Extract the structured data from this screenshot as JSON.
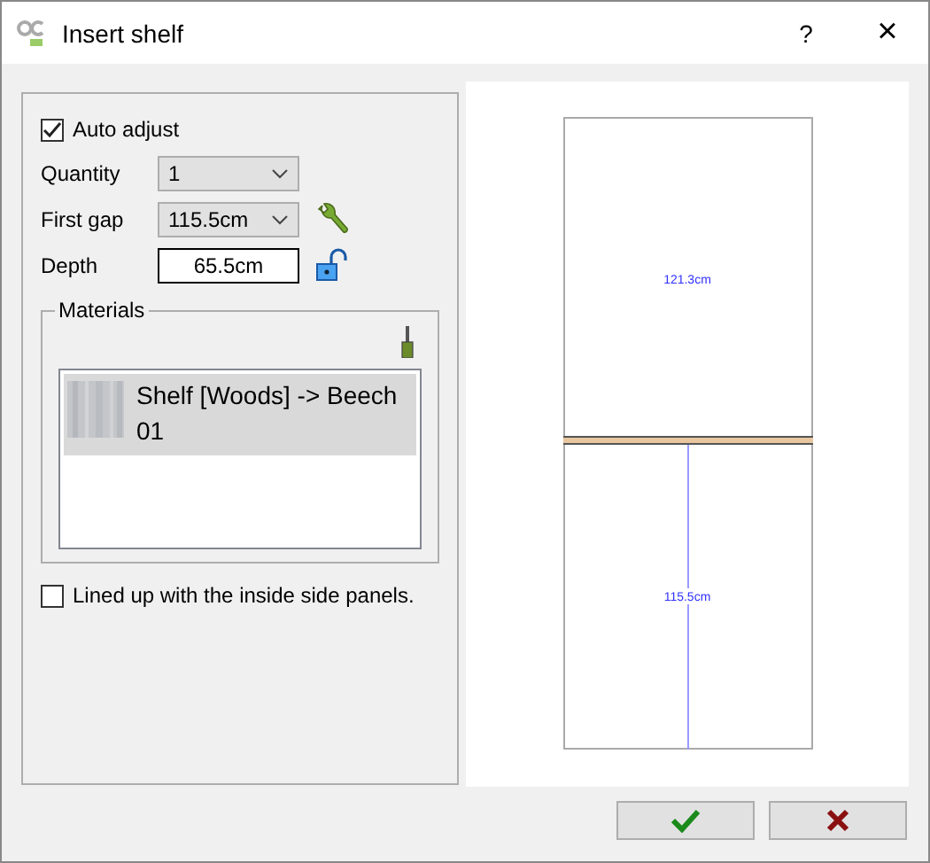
{
  "window": {
    "title": "Insert shelf",
    "help": "?",
    "close": "×"
  },
  "auto_adjust": {
    "label": "Auto adjust",
    "checked": true
  },
  "fields": [
    {
      "kind": "combo",
      "label": "Quantity",
      "value": "1"
    },
    {
      "kind": "combo",
      "label": "First gap",
      "value": "115.5cm"
    },
    {
      "kind": "input",
      "label": "Depth",
      "value": "65.5cm",
      "locked": false
    }
  ],
  "materials": {
    "title": "Materials",
    "items": [
      {
        "label": "Shelf [Woods] -> Beech 01",
        "selected": true
      }
    ]
  },
  "lined_up": {
    "label": "Lined up with the inside side panels.",
    "checked": false
  },
  "preview": {
    "top_height": "121.3cm",
    "bottom_height": "115.5cm"
  },
  "buttons": [
    {
      "kind": "ok"
    },
    {
      "kind": "cancel"
    }
  ]
}
